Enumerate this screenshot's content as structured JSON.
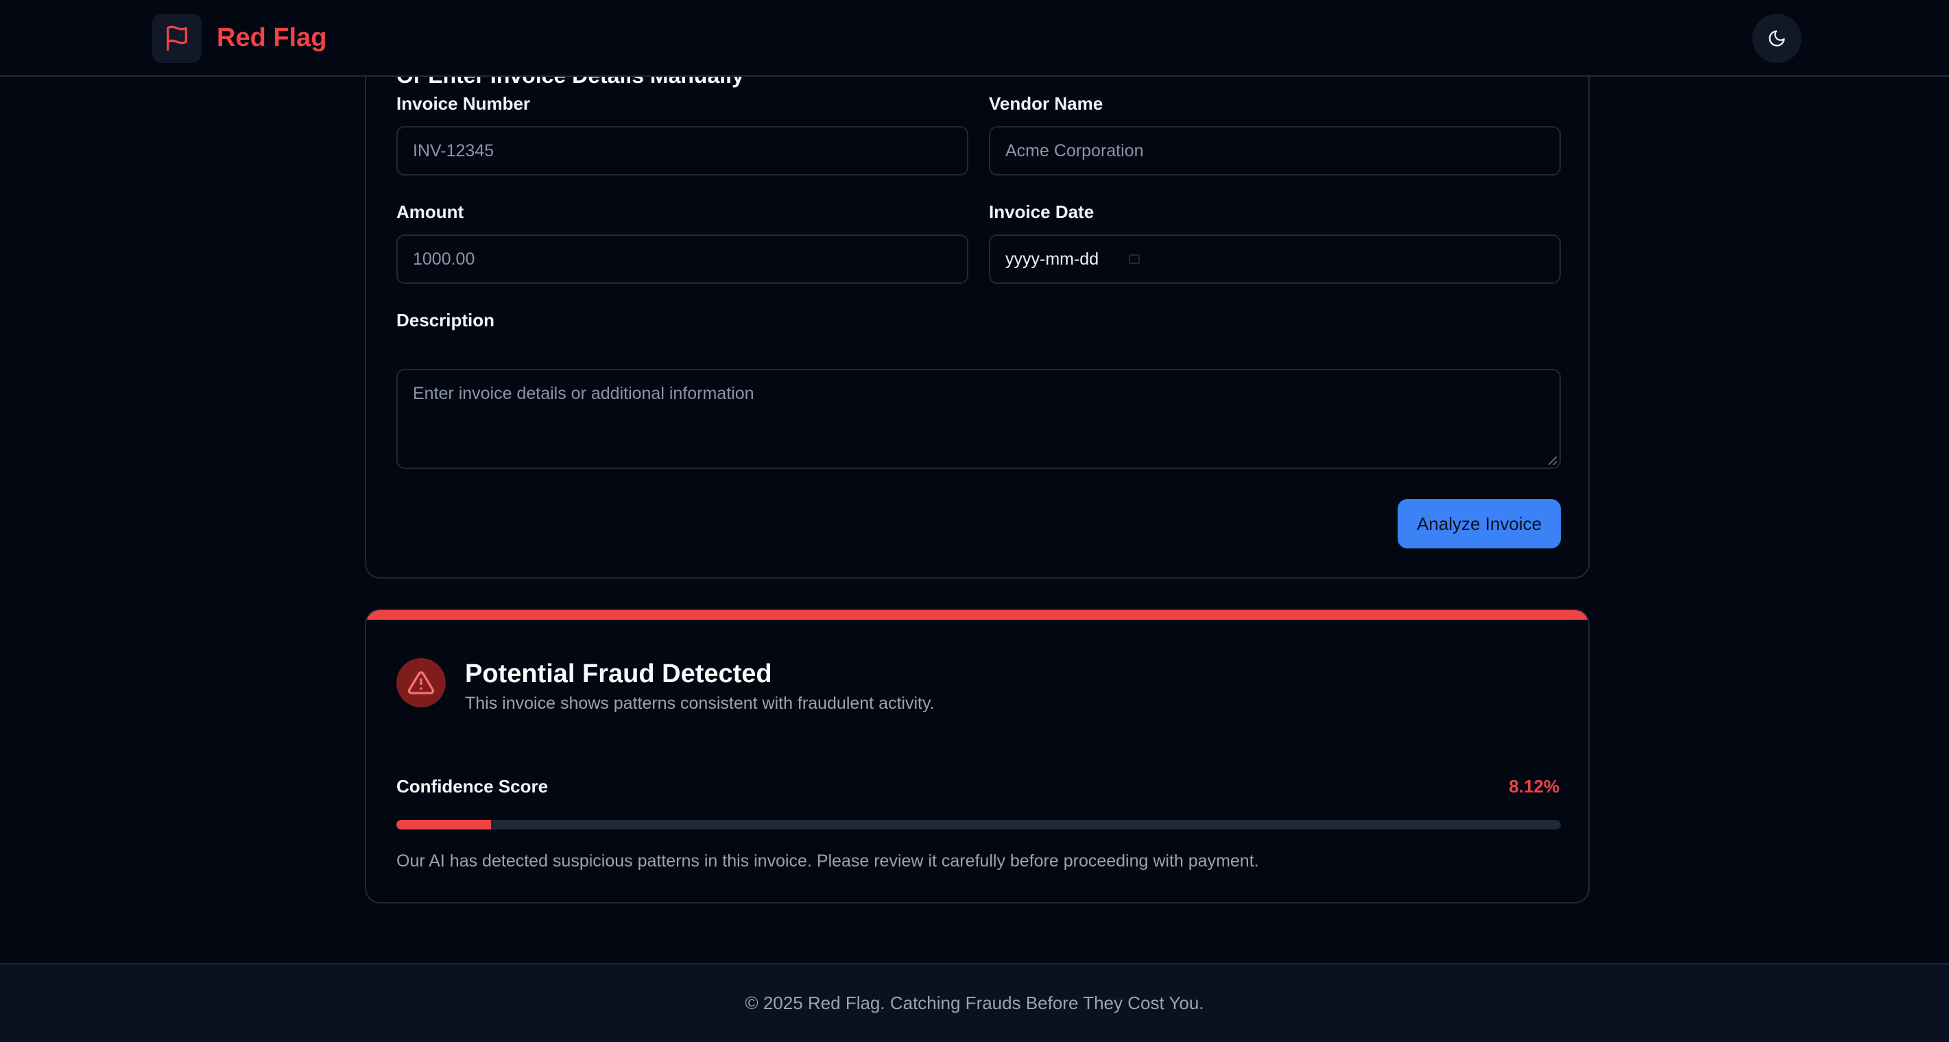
{
  "header": {
    "brand": "Red Flag",
    "logo_icon": "flag-icon",
    "theme_icon": "moon-icon"
  },
  "form": {
    "heading": "Or Enter Invoice Details Manually",
    "invoice_number": {
      "label": "Invoice Number",
      "placeholder": "INV-12345"
    },
    "vendor_name": {
      "label": "Vendor Name",
      "placeholder": "Acme Corporation"
    },
    "amount": {
      "label": "Amount",
      "placeholder": "1000.00"
    },
    "invoice_date": {
      "label": "Invoice Date",
      "placeholder": "yyyy-mm-dd"
    },
    "description": {
      "label": "Description",
      "placeholder": "Enter invoice details or additional information"
    },
    "submit_label": "Analyze Invoice"
  },
  "result": {
    "icon": "alert-triangle-icon",
    "title": "Potential Fraud Detected",
    "subtitle": "This invoice shows patterns consistent with fraudulent activity.",
    "score_label": "Confidence Score",
    "score_text": "8.12%",
    "score_fraction": 0.0812,
    "note": "Our AI has detected suspicious patterns in this invoice. Please review it carefully before proceeding with payment."
  },
  "footer": {
    "text": "© 2025 Red Flag. Catching Frauds Before They Cost You."
  },
  "colors": {
    "background": "#030712",
    "accent_red": "#ef4444",
    "primary_blue": "#3b82f6",
    "border": "#1f2937"
  }
}
